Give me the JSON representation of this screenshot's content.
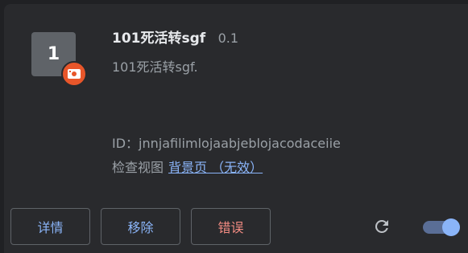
{
  "extension": {
    "icon_letter": "1",
    "name": "101死活转sgf",
    "version": "0.1",
    "description": "101死活转sgf.",
    "id_label": "ID：",
    "id": "jnnjafilimlojaabjeblojacodaceiie",
    "inspect_label": "检查视图",
    "inspect_link": "背景页 （无效）"
  },
  "buttons": {
    "details": "详情",
    "remove": "移除",
    "errors": "错误"
  },
  "toggle": {
    "enabled": true
  },
  "colors": {
    "accent": "#8ab4f8",
    "error": "#f28b82",
    "badge": "#e8562a",
    "background": "#292a2d"
  },
  "icons": {
    "badge": "unpacked-extension-icon",
    "reload": "reload-icon"
  }
}
